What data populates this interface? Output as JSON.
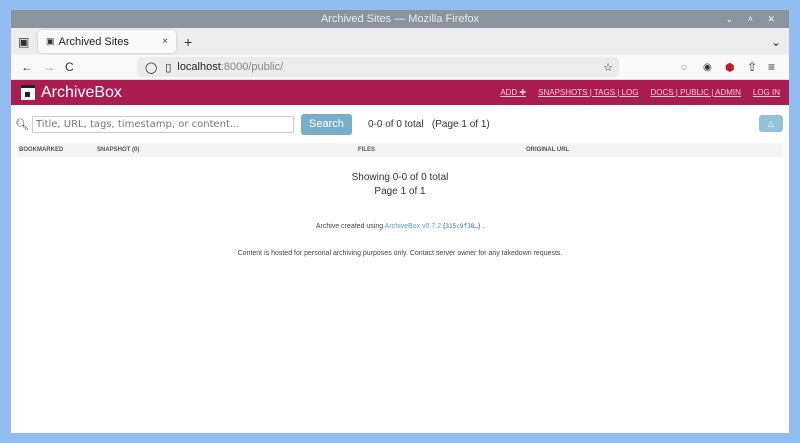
{
  "window": {
    "title": "Archived Sites — Mozilla Firefox",
    "controls": "⌄ ˄ ✕"
  },
  "tab": {
    "label": "Archived Sites",
    "close": "×",
    "new": "+",
    "list": "⌄"
  },
  "nav": {
    "back": "←",
    "forward": "→",
    "reload": "C",
    "url_host": "localhost",
    "url_rest": ":8000/public/",
    "star": "☆",
    "menu": "≡"
  },
  "header": {
    "brand": "ArchiveBox",
    "links": [
      "ADD ✚",
      "SNAPSHOTS | TAGS | LOG",
      "DOCS | PUBLIC | ADMIN",
      "LOG IN"
    ]
  },
  "search": {
    "placeholder": "Title, URL, tags, timestamp, or content...",
    "button": "Search",
    "count": "0-0 of 0 total   (Page 1 of 1)",
    "up": "△"
  },
  "table": {
    "headers": [
      "BOOKMARKED",
      "SNAPSHOT (0)",
      "FILES",
      "ORIGINAL URL"
    ]
  },
  "empty": {
    "line1": "Showing 0-0 of 0 total",
    "line2": "Page 1 of 1"
  },
  "footer": {
    "created_prefix": "Archive created using ",
    "link": "ArchiveBox v0.7.2",
    "commit_open": " (",
    "commit": "315c9f38…",
    "commit_close": ") .",
    "notice": "Content is hosted for personal archiving purposes only. Contact server owner for any takedown requests."
  }
}
